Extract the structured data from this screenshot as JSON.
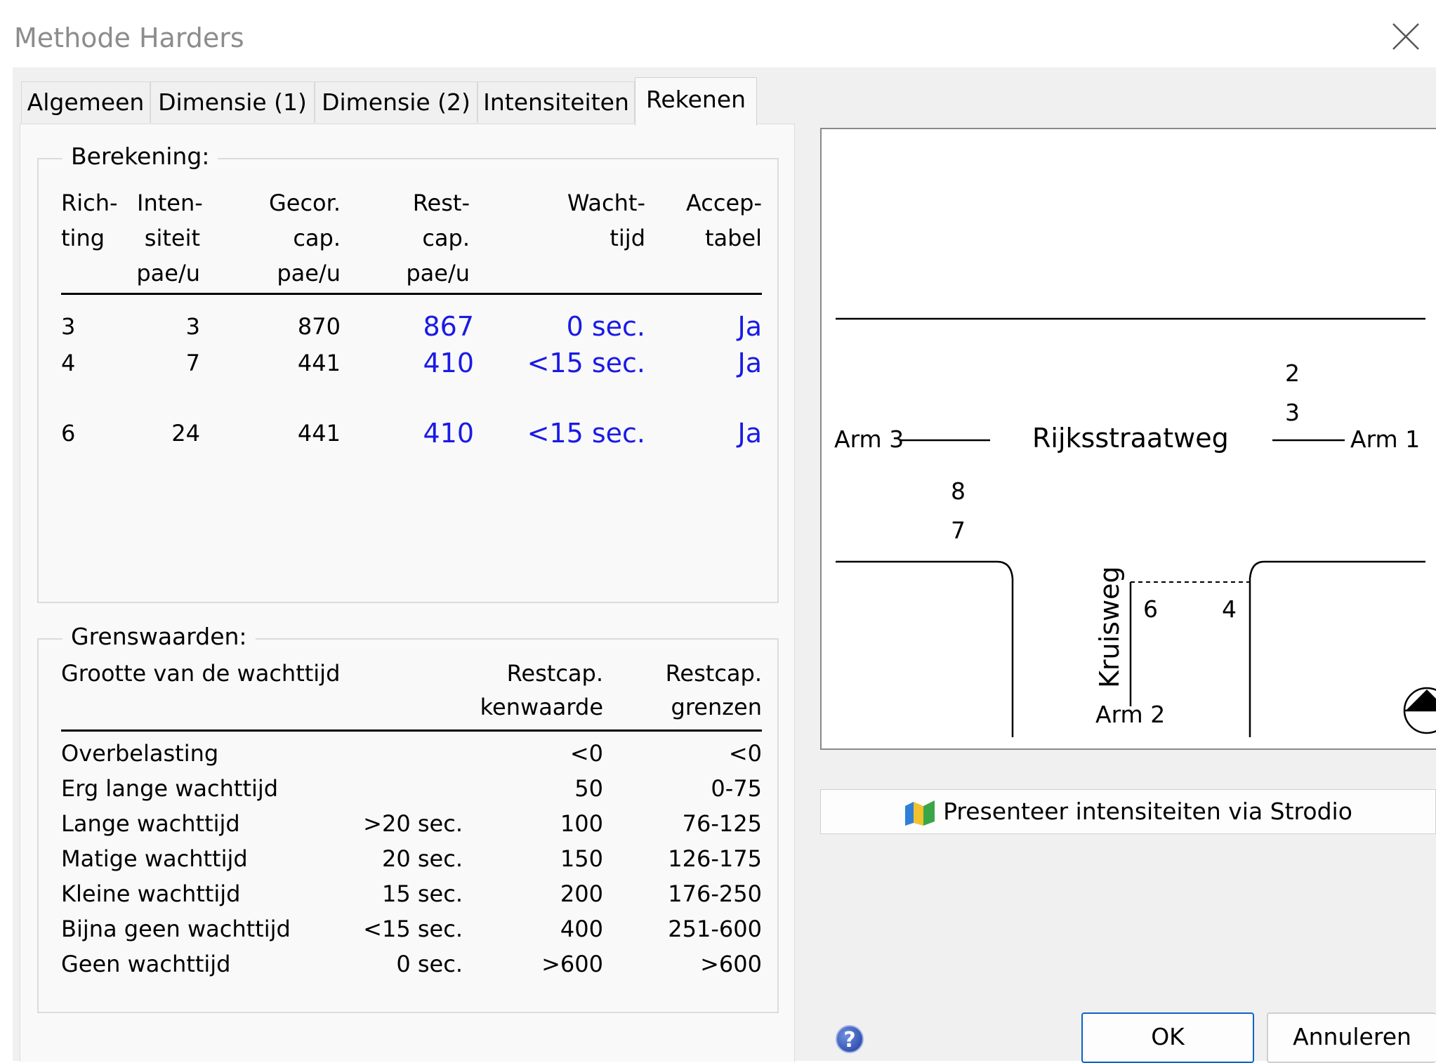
{
  "window": {
    "title": "Methode Harders"
  },
  "tabs": [
    "Algemeen",
    "Dimensie (1)",
    "Dimensie (2)",
    "Intensiteiten",
    "Rekenen"
  ],
  "berekening": {
    "label": "Berekening:",
    "headers": [
      [
        "Rich-",
        "ting",
        ""
      ],
      [
        "Inten-",
        "siteit",
        "pae/u"
      ],
      [
        "Gecor.",
        "cap.",
        "pae/u"
      ],
      [
        "Rest-",
        "cap.",
        "pae/u"
      ],
      [
        "Wacht-",
        "tijd",
        ""
      ],
      [
        "Accep-",
        "tabel",
        ""
      ]
    ],
    "rows": [
      [
        "3",
        "3",
        "870",
        "867",
        "0 sec.",
        "Ja"
      ],
      [
        "4",
        "7",
        "441",
        "410",
        "<15 sec.",
        "Ja"
      ],
      [
        "6",
        "24",
        "441",
        "410",
        "<15 sec.",
        "Ja"
      ]
    ]
  },
  "grenswaarden": {
    "label": "Grenswaarden:",
    "headers": {
      "col1": "Grootte van de wachttijd",
      "col3": [
        "Restcap.",
        "kenwaarde"
      ],
      "col4": [
        "Restcap.",
        "grenzen"
      ]
    },
    "rows": [
      [
        "Overbelasting",
        "",
        "<0",
        "<0"
      ],
      [
        "Erg lange wachttijd",
        "",
        "50",
        "0-75"
      ],
      [
        "Lange wachttijd",
        ">20 sec.",
        "100",
        "76-125"
      ],
      [
        "Matige wachttijd",
        "20 sec.",
        "150",
        "126-175"
      ],
      [
        "Kleine wachttijd",
        "15 sec.",
        "200",
        "176-250"
      ],
      [
        "Bijna geen wachttijd",
        "<15 sec.",
        "400",
        "251-600"
      ],
      [
        "Geen wachttijd",
        "0 sec.",
        ">600",
        ">600"
      ]
    ]
  },
  "diagram": {
    "main_road": "Rijksstraatweg",
    "side_road": "Kruisweg",
    "arm1": "Arm 1",
    "arm2": "Arm 2",
    "arm3": "Arm 3",
    "dir_2": "2",
    "dir_3": "3",
    "dir_8": "8",
    "dir_7": "7",
    "dir_6": "6",
    "dir_4": "4"
  },
  "buttons": {
    "strodio": "Presenteer intensiteiten via Strodio",
    "ok": "OK",
    "cancel": "Annuleren"
  },
  "colors": {
    "value_blue": "#1a1ae6",
    "default_button_border": "#0a64c8"
  }
}
